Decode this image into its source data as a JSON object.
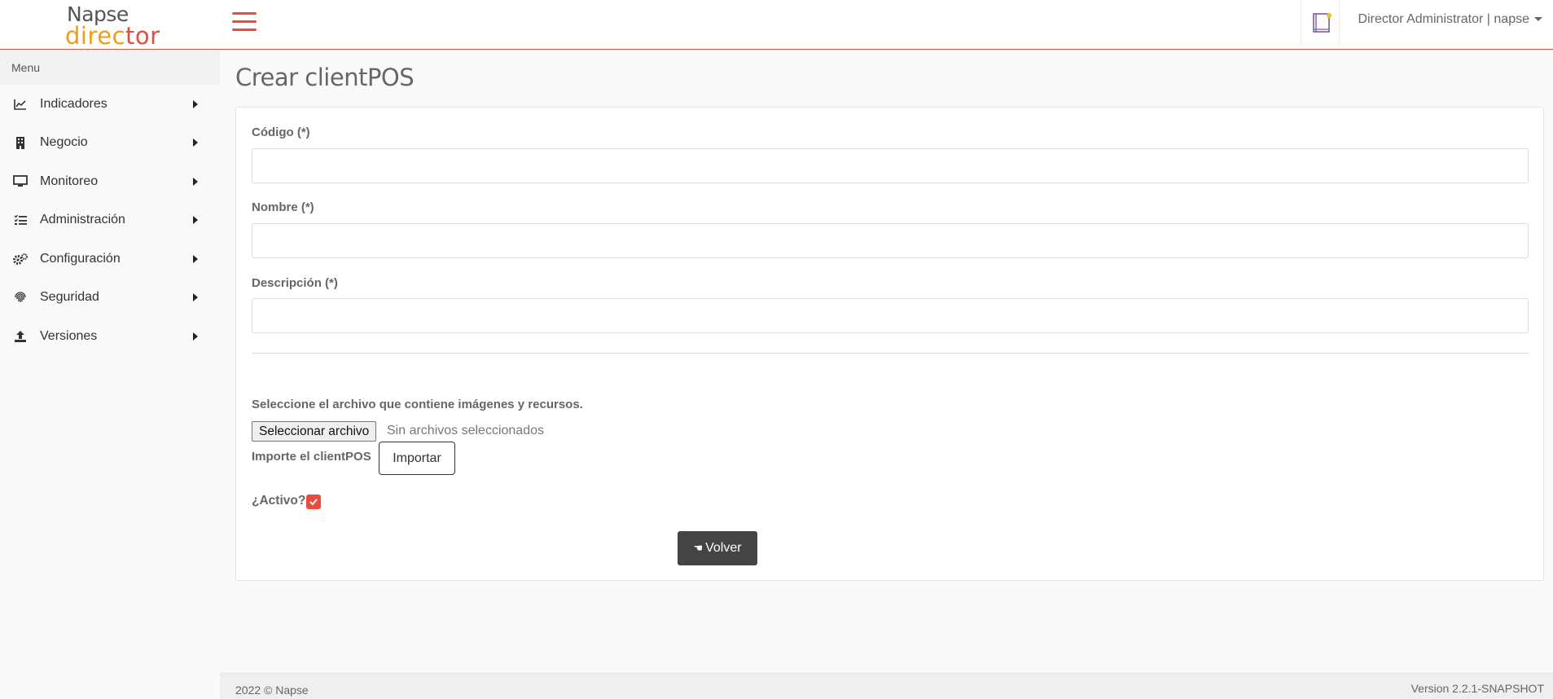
{
  "brand": {
    "line1": "Napse",
    "line2": "director",
    "colors": [
      "#f39c12",
      "#e74c3c"
    ]
  },
  "header": {
    "menu_icon": "hamburger-icon",
    "notes_icon": "notebook-icon",
    "user": "Director Administrator | napse"
  },
  "sidebar": {
    "heading": "Menu",
    "items": [
      {
        "label": "Indicadores",
        "icon": "chart-line-icon"
      },
      {
        "label": "Negocio",
        "icon": "building-icon"
      },
      {
        "label": "Monitoreo",
        "icon": "monitor-icon"
      },
      {
        "label": "Administración",
        "icon": "tasks-list-icon"
      },
      {
        "label": "Configuración",
        "icon": "gears-icon"
      },
      {
        "label": "Seguridad",
        "icon": "fingerprint-icon"
      },
      {
        "label": "Versiones",
        "icon": "upload-icon"
      }
    ]
  },
  "page": {
    "title": "Crear clientPOS"
  },
  "form": {
    "codigo_label": "Código (*)",
    "codigo_value": "",
    "nombre_label": "Nombre (*)",
    "nombre_value": "",
    "descripcion_label": "Descripción (*)",
    "descripcion_value": "",
    "file_instructions": "Seleccione el archivo que contiene imágenes y recursos.",
    "file_button": "Seleccionar archivo",
    "file_status": "Sin archivos seleccionados",
    "import_label": "Importe el clientPOS",
    "import_button": "Importar",
    "active_label": "¿Activo?",
    "active_checked": true,
    "back_button": "Volver",
    "back_icon": "hand-pointing-left-icon"
  },
  "footer": {
    "copyright": "2022 © Napse",
    "version": "Version 2.2.1-SNAPSHOT"
  },
  "colors": {
    "accent": "#e74c3c",
    "dark_button": "#444444"
  }
}
